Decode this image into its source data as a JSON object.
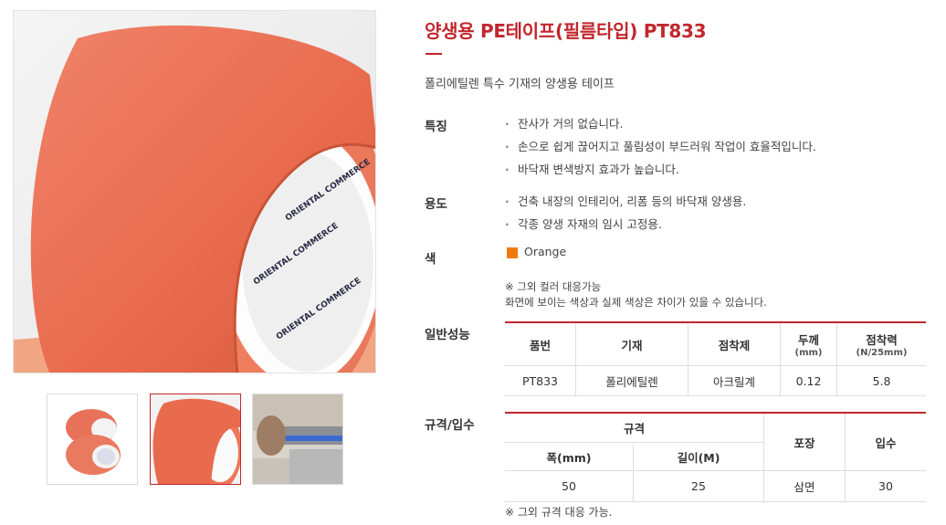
{
  "product": {
    "title": "양생용 PE테이프(필름타입)  PT833",
    "description": "폴리에틸렌 특수 기재의 양생용 테이프"
  },
  "tape_print_text": "ORIENTAL COMMERCE",
  "features": {
    "label": "특징",
    "items": [
      "잔사가 거의 없습니다.",
      "손으로 쉽게 끊어지고 풀림성이 부드러워 작업이 효율적입니다.",
      "바닥재 변색방지 효과가 높습니다."
    ]
  },
  "usage": {
    "label": "용도",
    "items": [
      "건축 내장의 인테리어, 리폼 등의 바닥재 양생용.",
      "각종 양생 자재의 임시 고정용."
    ]
  },
  "color": {
    "label": "색",
    "name": "Orange",
    "swatch_hex": "#f07a0e",
    "note1": "※ 그외 컬러 대응가능",
    "note2": "화면에 보이는 색상과 실제 색상은 차이가 있을 수 있습니다."
  },
  "performance": {
    "label": "일반성능",
    "headers": {
      "product_no": "품번",
      "base": "기재",
      "adhesive": "점착제",
      "thickness": "두께",
      "thickness_unit": "(mm)",
      "adhesion": "점착력",
      "adhesion_unit": "(N/25mm)"
    },
    "row": {
      "product_no": "PT833",
      "base": "폴리에틸렌",
      "adhesive": "아크릴계",
      "thickness": "0.12",
      "adhesion": "5.8"
    }
  },
  "spec": {
    "label": "규격/입수",
    "headers": {
      "size": "규격",
      "width": "폭(mm)",
      "length": "길이(M)",
      "packing": "포장",
      "quantity": "입수"
    },
    "row": {
      "width": "50",
      "length": "25",
      "packing": "삼면",
      "quantity": "30"
    },
    "footnote": "※ 그외 규격 대응 가능."
  },
  "colors": {
    "accent": "#c1272d",
    "tape": "#f07a0e"
  }
}
